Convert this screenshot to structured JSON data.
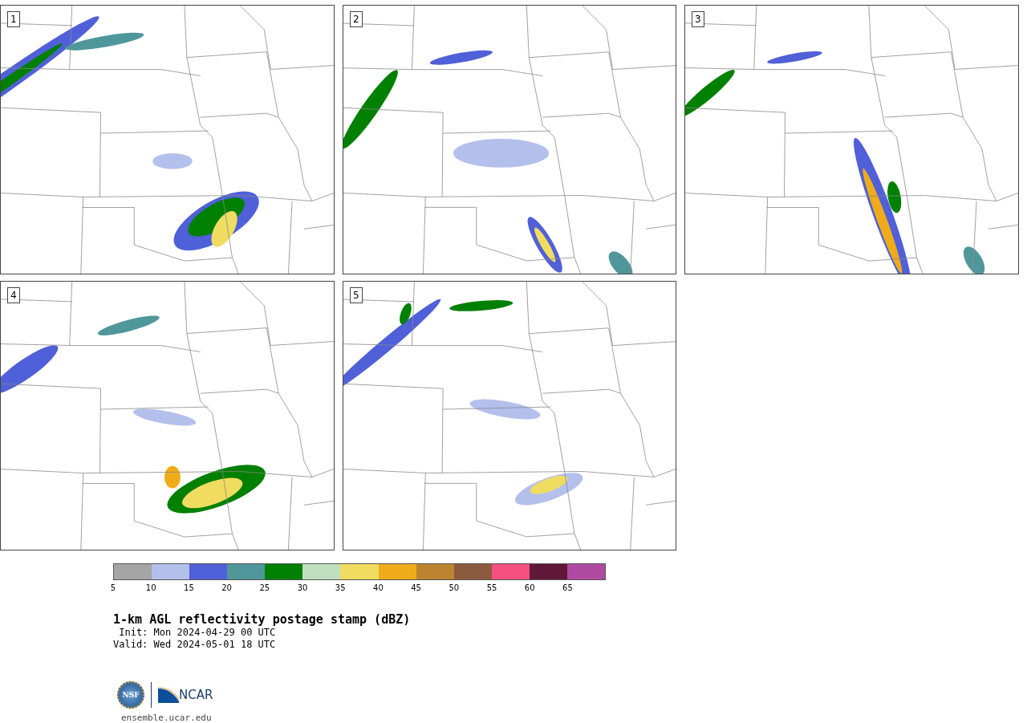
{
  "panels": [
    {
      "label": "1"
    },
    {
      "label": "2"
    },
    {
      "label": "3"
    },
    {
      "label": "4"
    },
    {
      "label": "5"
    }
  ],
  "colorbar": {
    "bins": [
      {
        "color": "#a5a5a5"
      },
      {
        "color": "#b4c0ec"
      },
      {
        "color": "#5060d8"
      },
      {
        "color": "#50979c"
      },
      {
        "color": "#008000"
      },
      {
        "color": "#bfdfbf"
      },
      {
        "color": "#f0dc60"
      },
      {
        "color": "#f0ac18"
      },
      {
        "color": "#bc8430"
      },
      {
        "color": "#8c5a3e"
      },
      {
        "color": "#f45080"
      },
      {
        "color": "#601838"
      },
      {
        "color": "#b04aa0"
      }
    ],
    "ticks": [
      "5",
      "10",
      "15",
      "20",
      "25",
      "30",
      "35",
      "40",
      "45",
      "50",
      "55",
      "60",
      "65"
    ]
  },
  "title": "1-km AGL reflectivity postage stamp (dBZ)",
  "init": " Init: Mon 2024-04-29 00 UTC",
  "valid": "Valid: Wed 2024-05-01 18 UTC",
  "logos": {
    "left": "NSF",
    "right": "NCAR"
  },
  "url": "ensemble.ucar.edu"
}
